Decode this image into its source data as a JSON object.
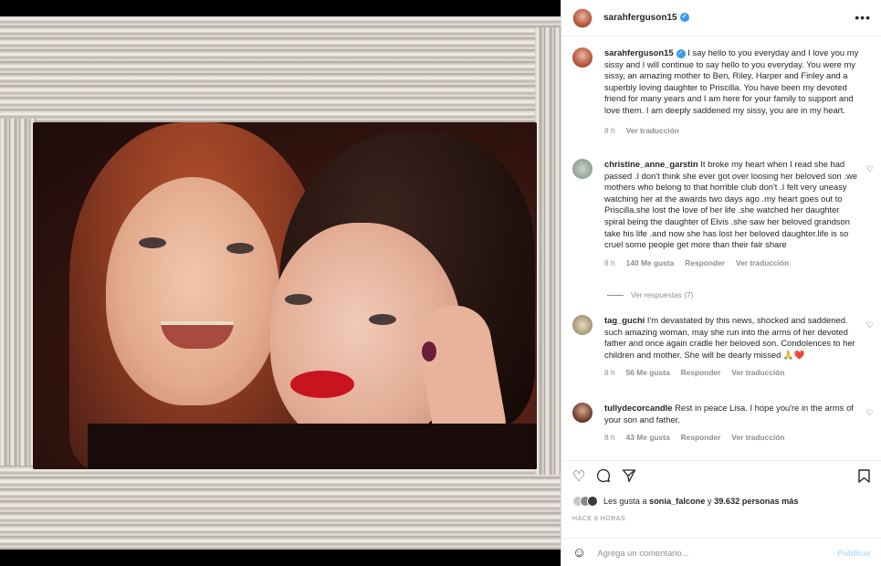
{
  "post": {
    "username": "sarahferguson15"
  },
  "caption": {
    "username": "sarahferguson15",
    "text": "I say hello to you everyday and I love you my sissy and I will continue to say hello to you everyday. You were my sissy, an amazing mother to Ben, Riley, Harper and Finley and a superbly loving daughter to Priscilla. You have been my devoted friend for many years and I am here for your family to support and love them. I am deeply saddened my sissy, you are in my heart.",
    "time": "8 h",
    "translate": "Ver traducción"
  },
  "comments": [
    {
      "username": "christine_anne_garstin",
      "text": "It broke my heart when I read she had passed .I don't think she ever got over loosing her beloved son .we mothers who belong to that horrible club don't .I felt very uneasy watching her at the awards two days ago .my heart goes out to Priscilla.she lost the love of her life .she watched her daughter spiral being the daughter of Elvis .she saw her beloved grandson take his life .and now she has lost her beloved daughter.life is so cruel some people get more than their fair share",
      "time": "8 h",
      "likes": "140 Me gusta",
      "reply": "Responder",
      "translate": "Ver traducción",
      "view_replies": "Ver respuestas (7)"
    },
    {
      "username": "tag_guchi",
      "text": "I'm devastated by this news, shocked and saddened. such amazing woman, may she run into the arms of her devoted father and once again cradle her beloved son. Condolences to her children and mother. She will be dearly missed 🙏❤️",
      "time": "8 h",
      "likes": "56 Me gusta",
      "reply": "Responder",
      "translate": "Ver traducción"
    },
    {
      "username": "tullydecorcandle",
      "text": "Rest in peace Lisa. I hope you're in the arms of your son and father.",
      "time": "8 h",
      "likes": "43 Me gusta",
      "reply": "Responder",
      "translate": "Ver traducción"
    }
  ],
  "likes_summary": {
    "prefix": "Les gusta a",
    "user": "sonia_falcone",
    "middle": "y",
    "count": "39.632 personas más"
  },
  "time_ago": "HACE 8 HORAS",
  "add_comment": {
    "placeholder": "Agrega un comentario...",
    "publish": "Publicar"
  },
  "icons": {
    "verified": "verified-badge-icon",
    "more": "more-options-icon",
    "like": "heart-icon",
    "comment": "comment-icon",
    "share": "share-icon",
    "save": "bookmark-icon",
    "emoji": "emoji-icon"
  },
  "colors": {
    "verified": "#3897f0",
    "publish_disabled": "#b2dffc",
    "heart_red": "#ed4956"
  }
}
